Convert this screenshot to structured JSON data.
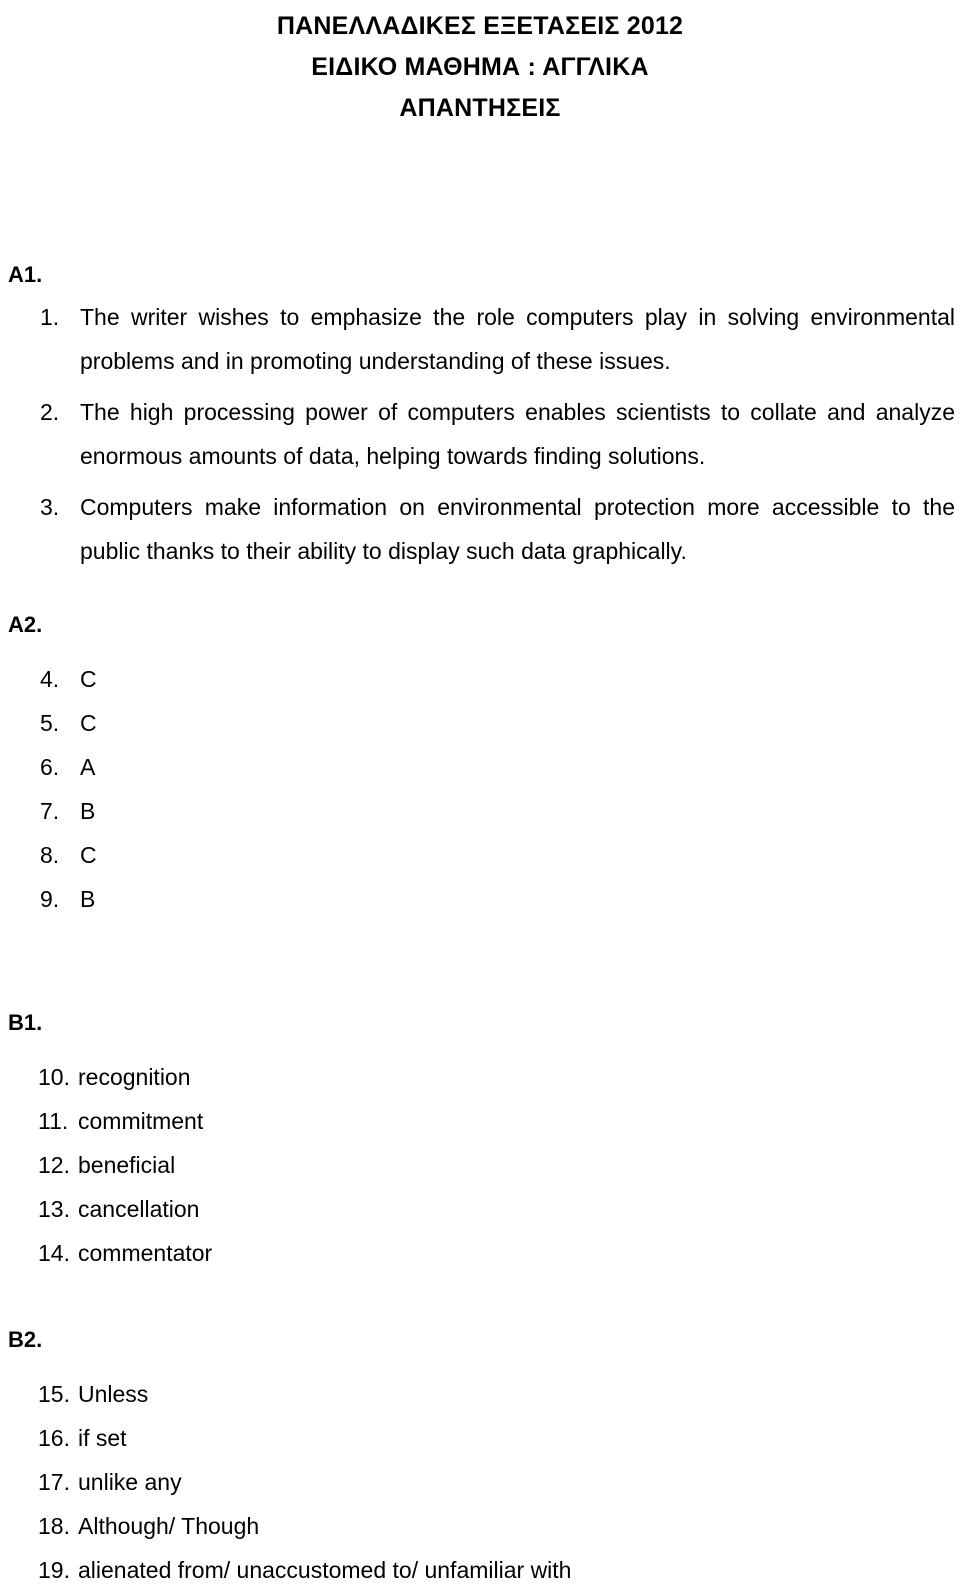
{
  "document": {
    "header_lines": [
      "ΠΑΝΕΛΛΑΔΙΚΕΣ ΕΞΕΤΑΣΕΙΣ 2012",
      "ΕΙΔΙΚΟ ΜΑΘΗΜΑ : ΑΓΓΛΙΚΑ",
      "ΑΠΑΝΤΗΣΕΙΣ"
    ],
    "text_color": "#000000",
    "background_color": "#ffffff"
  },
  "sections": [
    {
      "label": "A1.",
      "items": [
        {
          "number": "1.",
          "text": "The writer wishes to emphasize the role computers play in solving environmental problems and in promoting understanding of these issues."
        },
        {
          "number": "2.",
          "text": "The high processing power of computers enables scientists to collate and analyze enormous amounts of data, helping towards finding solutions."
        },
        {
          "number": "3.",
          "text": "Computers make information on environmental protection more accessible to the public thanks to their ability to display such data graphically."
        }
      ]
    },
    {
      "label": "A2.",
      "items": [
        {
          "number": "4.",
          "text": "C"
        },
        {
          "number": "5.",
          "text": "C"
        },
        {
          "number": "6.",
          "text": "A"
        },
        {
          "number": "7.",
          "text": "B"
        },
        {
          "number": "8.",
          "text": "C"
        },
        {
          "number": "9.",
          "text": "B"
        }
      ]
    },
    {
      "label": "B1.",
      "items": [
        {
          "number": "10.",
          "text": "recognition"
        },
        {
          "number": "11.",
          "text": "commitment"
        },
        {
          "number": "12.",
          "text": "beneficial"
        },
        {
          "number": "13.",
          "text": "cancellation"
        },
        {
          "number": "14.",
          "text": "commentator"
        }
      ]
    },
    {
      "label": "B2.",
      "items": [
        {
          "number": "15.",
          "text": "Unless"
        },
        {
          "number": "16.",
          "text": "if set"
        },
        {
          "number": "17.",
          "text": "unlike any"
        },
        {
          "number": "18.",
          "text": "Although/ Though"
        },
        {
          "number": "19.",
          "text": "alienated from/ unaccustomed to/ unfamiliar with"
        }
      ]
    }
  ]
}
